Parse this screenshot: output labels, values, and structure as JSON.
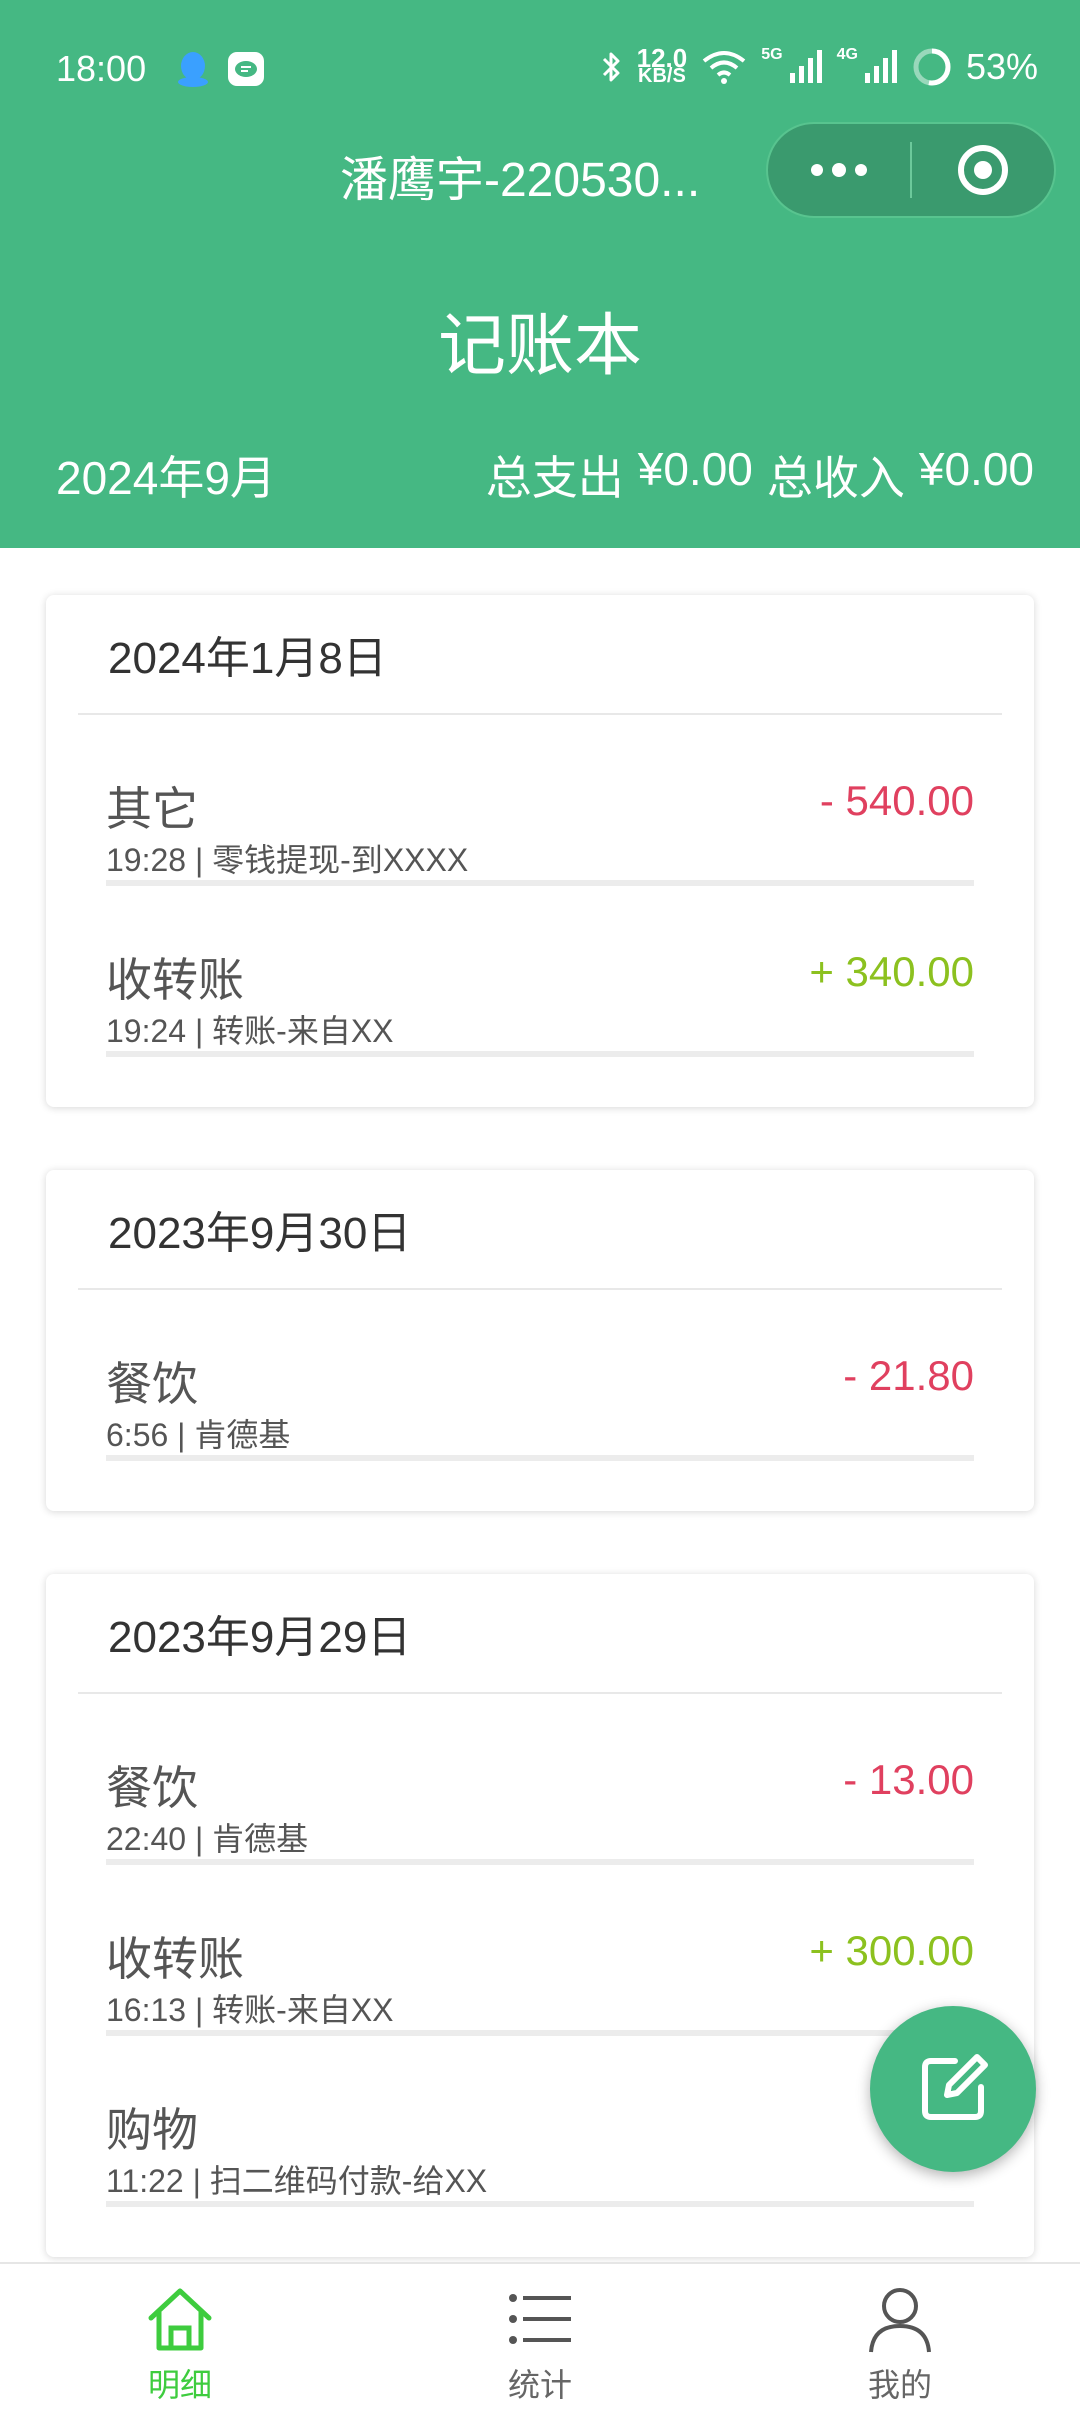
{
  "status_bar": {
    "time": "18:00",
    "net_speed_value": "12.0",
    "net_speed_unit": "KB/S",
    "signal_1_label": "5G",
    "signal_2_label": "4G",
    "battery": "53%",
    "battery_level": 0.53
  },
  "miniprogram": {
    "title": "潘鹰宇-220530...",
    "more_icon": "more-dots-icon",
    "close_icon": "target-close-icon"
  },
  "header": {
    "page_title": "记账本",
    "month": "2024年9月",
    "expense_label": "总支出",
    "expense_value": "¥0.00",
    "income_label": "总收入",
    "income_value": "¥0.00"
  },
  "days": [
    {
      "date": "2024年1月8日",
      "entries": [
        {
          "category": "其它",
          "detail": "19:28 | 零钱提现-到XXXX",
          "amount": "- 540.00",
          "direction": "out"
        },
        {
          "category": "收转账",
          "detail": "19:24 | 转账-来自XX",
          "amount": "+ 340.00",
          "direction": "in"
        }
      ]
    },
    {
      "date": "2023年9月30日",
      "entries": [
        {
          "category": "餐饮",
          "detail": "6:56 | 肯德基",
          "amount": "- 21.80",
          "direction": "out"
        }
      ]
    },
    {
      "date": "2023年9月29日",
      "entries": [
        {
          "category": "餐饮",
          "detail": "22:40 | 肯德基",
          "amount": "- 13.00",
          "direction": "out"
        },
        {
          "category": "收转账",
          "detail": "16:13 | 转账-来自XX",
          "amount": "+ 300.00",
          "direction": "in"
        },
        {
          "category": "购物",
          "detail": "11:22 | 扫二维码付款-给XX",
          "amount": "-",
          "direction": "out"
        }
      ]
    }
  ],
  "fab": {
    "icon": "edit-icon"
  },
  "tabbar": {
    "items": [
      {
        "label": "明细",
        "icon": "home-icon",
        "active": true
      },
      {
        "label": "统计",
        "icon": "list-icon",
        "active": false
      },
      {
        "label": "我的",
        "icon": "user-icon",
        "active": false
      }
    ]
  },
  "colors": {
    "primary": "#45b883",
    "expense": "#e0405f",
    "income": "#8cc11f",
    "tab_active": "#3ecc3e"
  }
}
